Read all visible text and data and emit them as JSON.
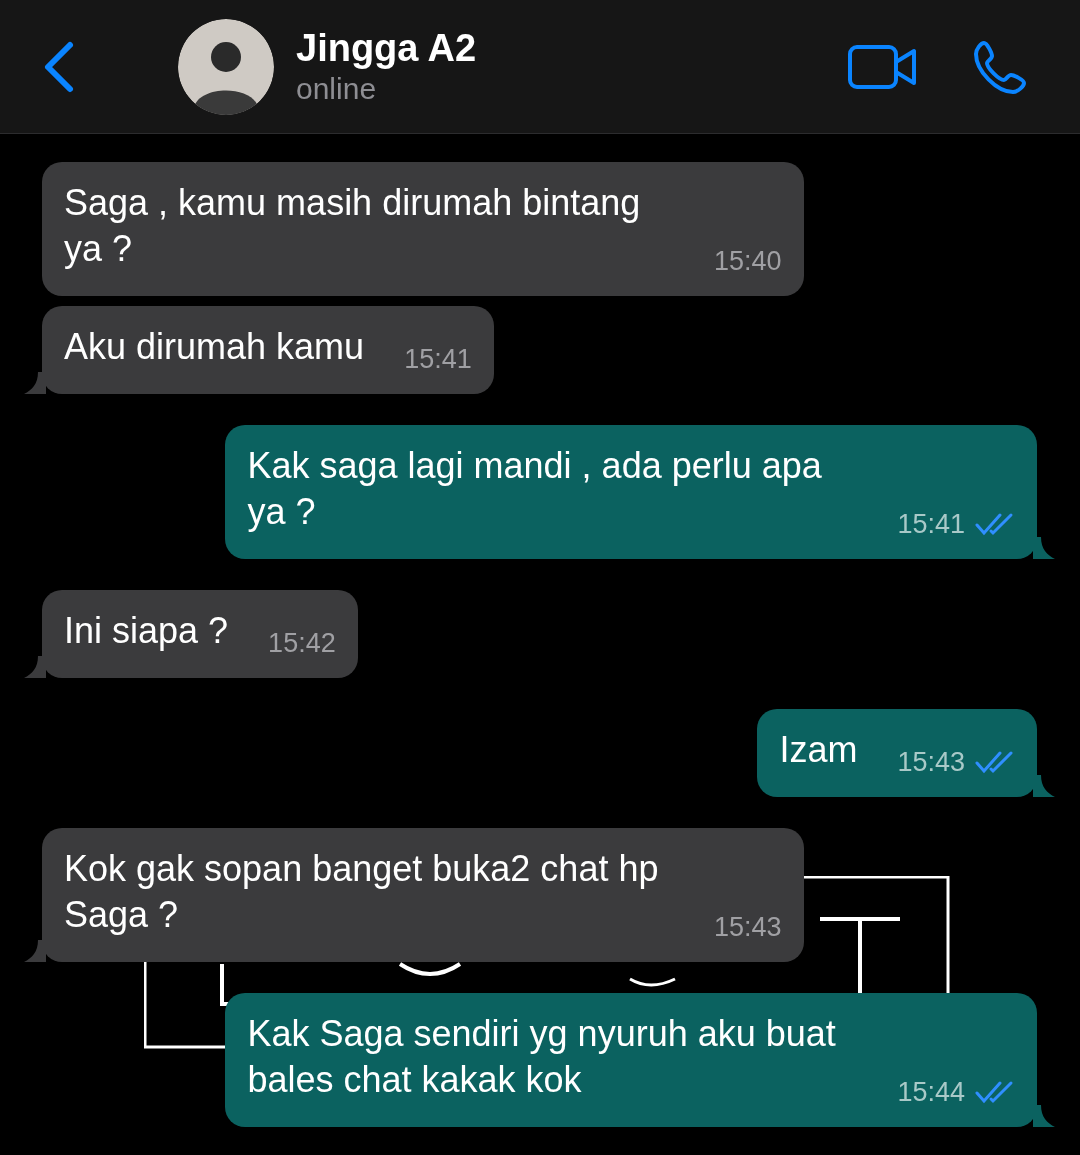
{
  "header": {
    "name": "Jingga A2",
    "status": "online"
  },
  "messages": [
    {
      "kind": "incoming",
      "text": "Saga , kamu masih dirumah bintang ya ?",
      "time": "15:40",
      "tail": false
    },
    {
      "kind": "incoming",
      "text": "Aku dirumah kamu",
      "time": "15:41",
      "tail": true
    },
    {
      "kind": "outgoing",
      "text": "Kak saga lagi mandi , ada perlu apa ya ?",
      "time": "15:41",
      "tail": true,
      "read": true
    },
    {
      "kind": "incoming",
      "text": "Ini siapa ?",
      "time": "15:42",
      "tail": true
    },
    {
      "kind": "outgoing",
      "text": "Izam",
      "time": "15:43",
      "tail": true,
      "read": true
    },
    {
      "kind": "incoming",
      "text": "Kok gak sopan banget buka2 chat hp Saga ?",
      "time": "15:43",
      "tail": true
    },
    {
      "kind": "outgoing",
      "text": "Kak Saga sendiri yg nyuruh aku buat bales chat kakak kok",
      "time": "15:44",
      "tail": true,
      "read": true
    }
  ]
}
